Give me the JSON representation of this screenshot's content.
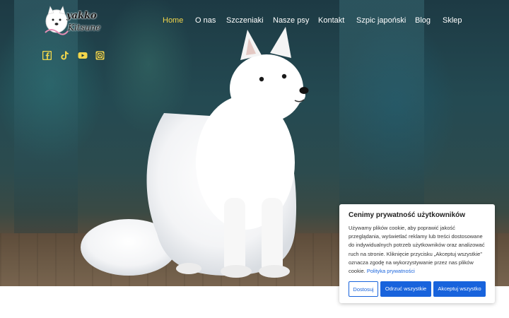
{
  "logo": {
    "line1": "yakko",
    "line2": "Kitsune"
  },
  "nav": {
    "items": [
      "Home",
      "O nas",
      "Szczeniaki",
      "Nasze psy",
      "Kontakt",
      "Szpic japoński",
      "Blog",
      "Sklep"
    ],
    "active": "Home",
    "active_color": "#f2d64b"
  },
  "social": [
    "facebook-icon",
    "tiktok-icon",
    "youtube-icon",
    "instagram-icon"
  ],
  "accent": "#f2d64b",
  "cookie": {
    "title": "Cenimy prywatność użytkowników",
    "body": "Używamy plików cookie, aby poprawić jakość przeglądania, wyświetlać reklamy lub treści dostosowane do indywidualnych potrzeb użytkowników oraz analizować ruch na stronie. Kliknięcie przycisku „Akceptuj wszystkie” oznacza zgodę na wykorzystywanie przez nas plików cookie.",
    "link": "Polityka prywatności",
    "customize": "Dostosuj",
    "reject": "Odrzuć wszystkie",
    "accept": "Akceptuj wszystko",
    "button_color": "#1863dc"
  }
}
